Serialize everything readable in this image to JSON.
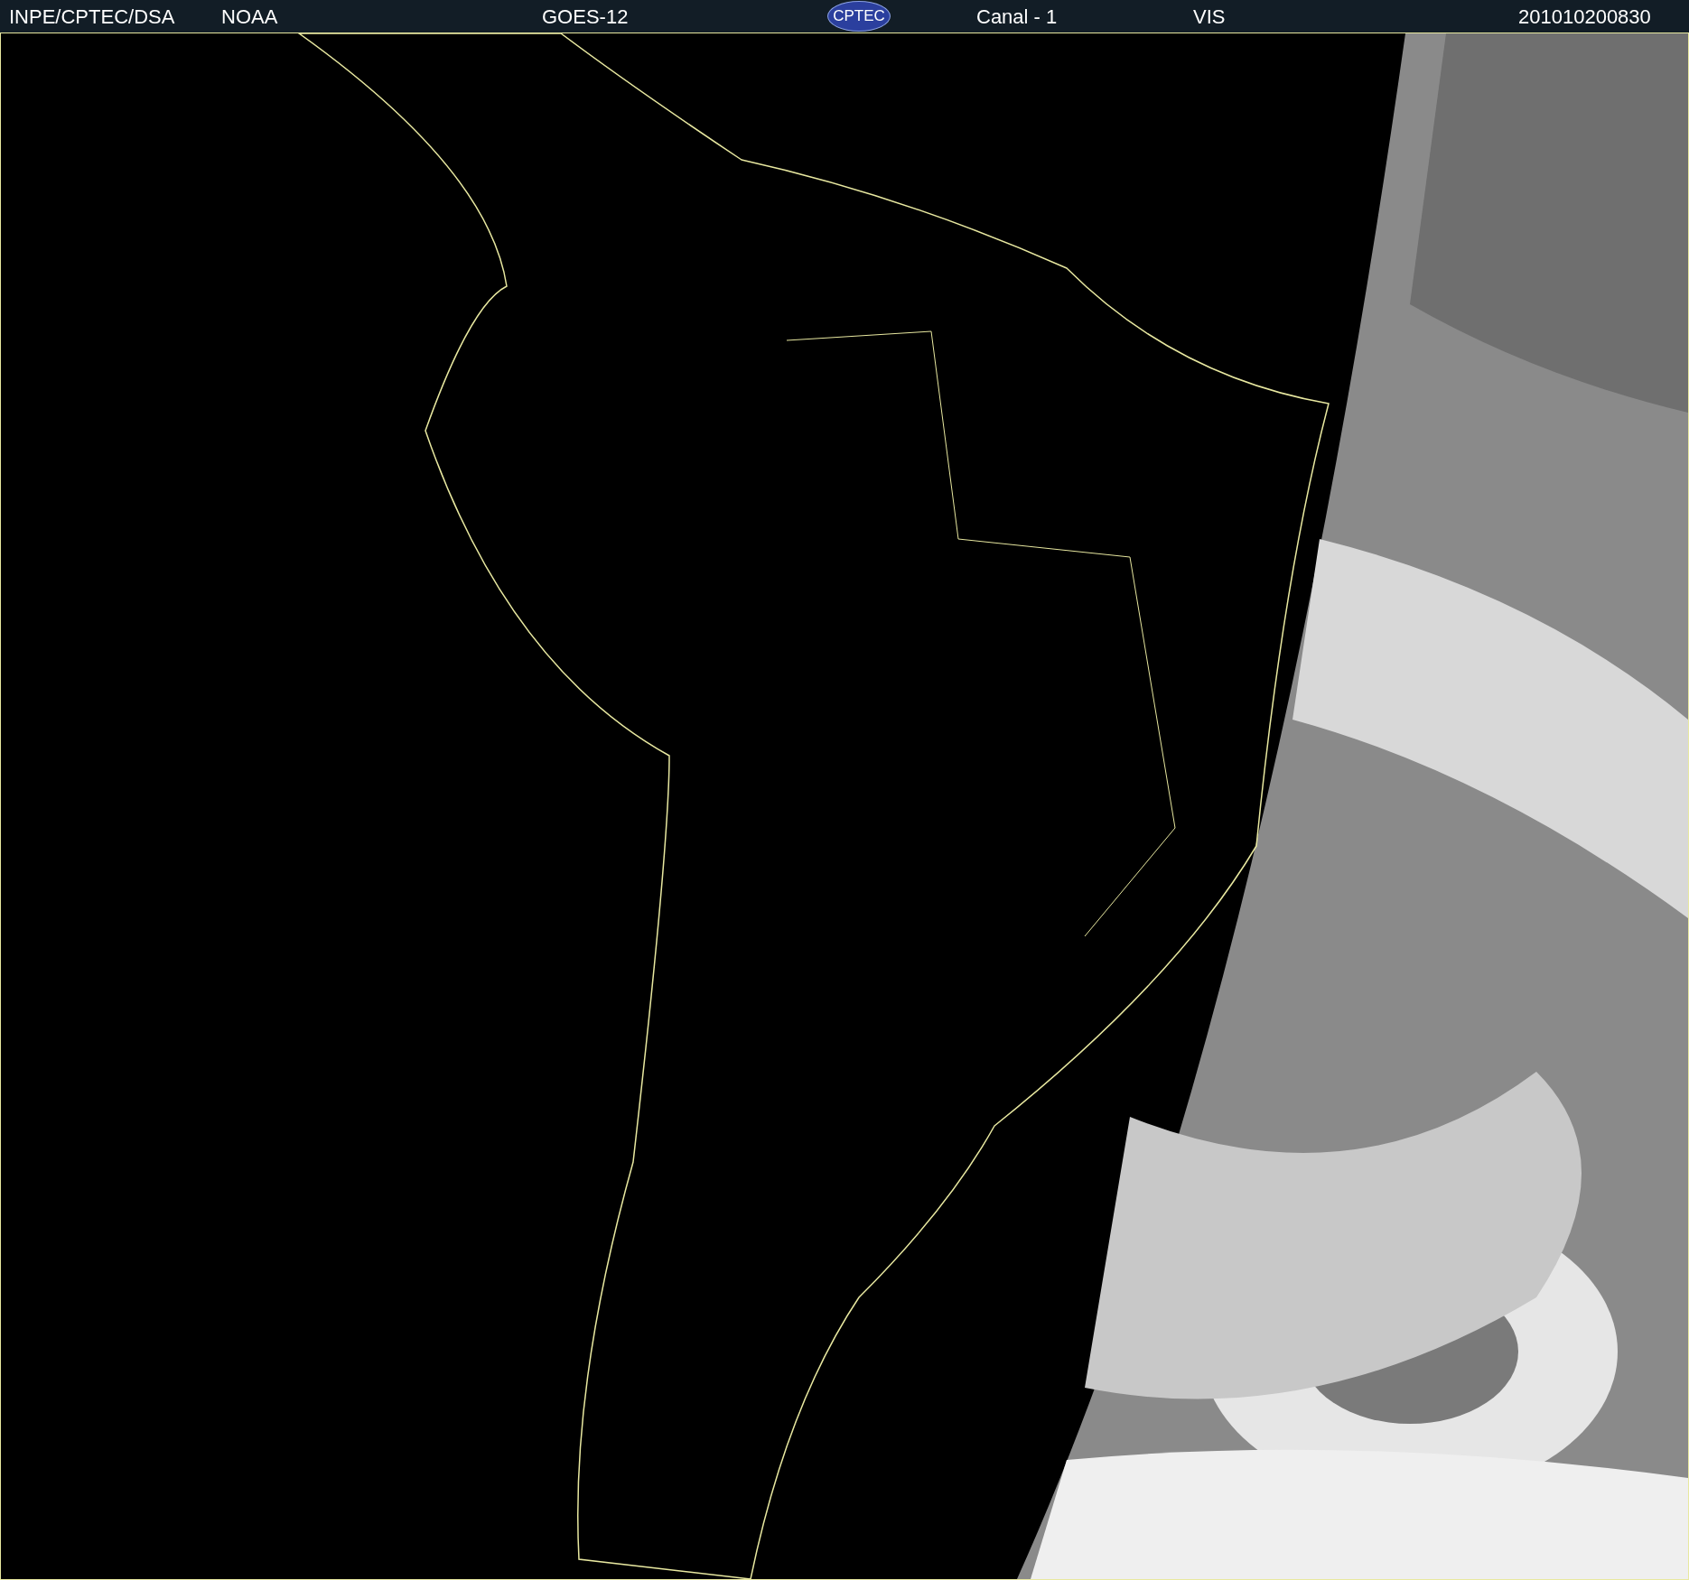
{
  "header": {
    "labels": [
      "INPE/CPTEC/DSA",
      "NOAA",
      "GOES-12"
    ],
    "logo": "CPTEC",
    "channel": "Canal - 1",
    "band": "VIS",
    "timestamp": "201010200830"
  }
}
